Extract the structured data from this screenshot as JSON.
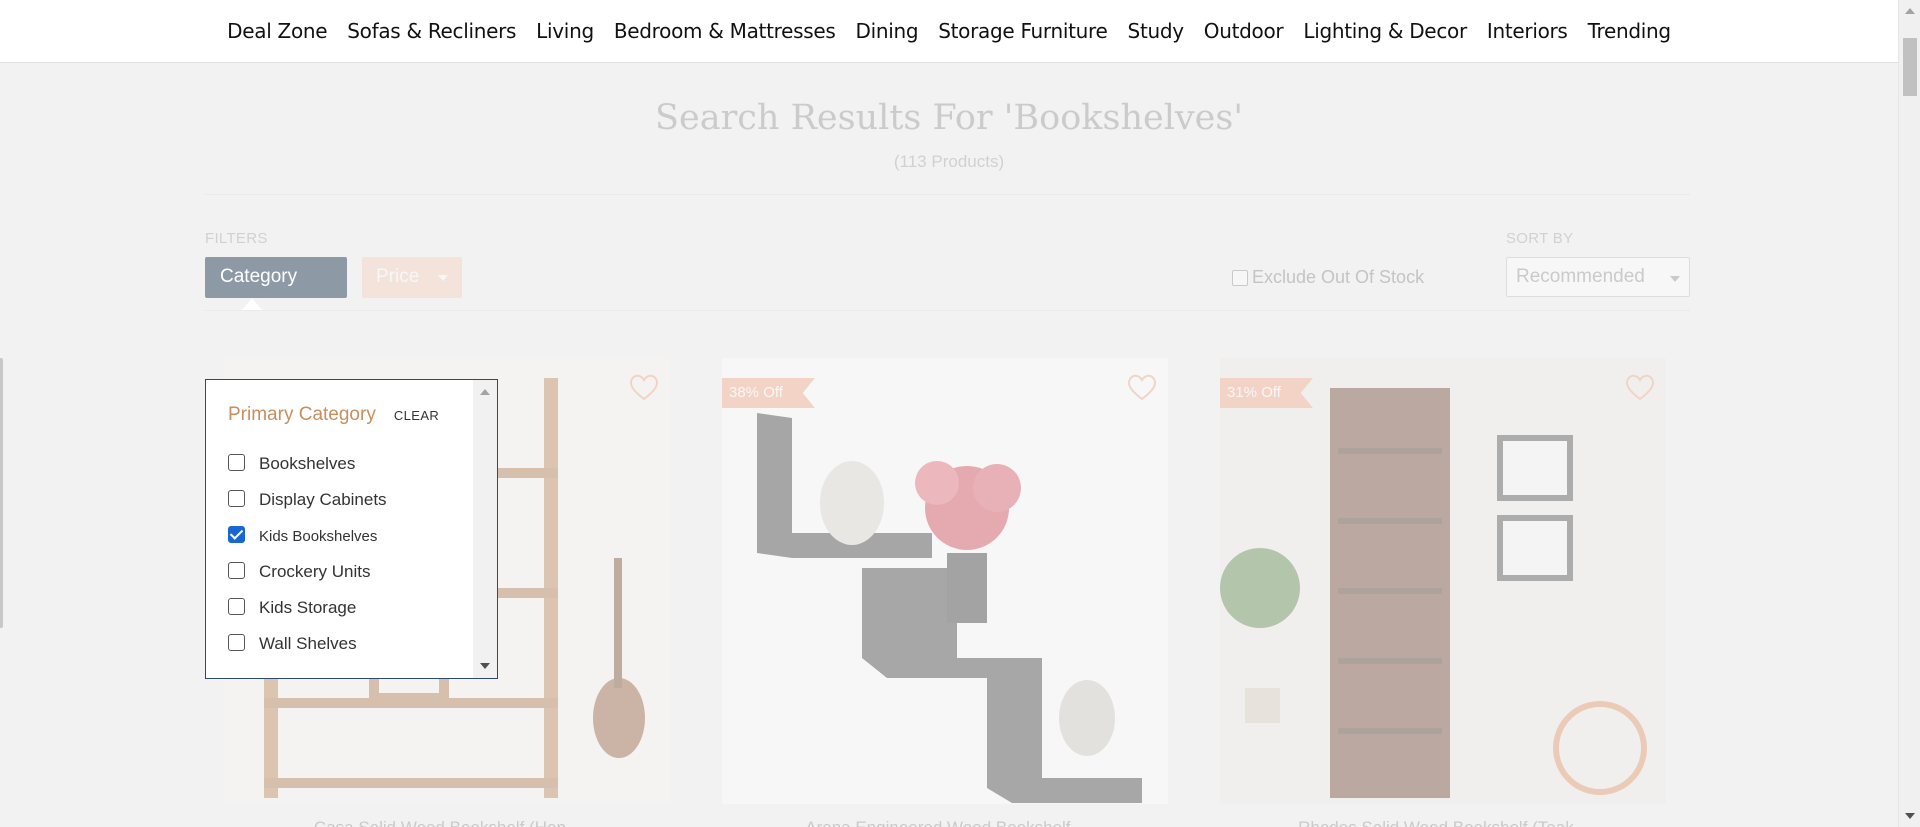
{
  "nav": {
    "items": [
      "Deal Zone",
      "Sofas & Recliners",
      "Living",
      "Bedroom & Mattresses",
      "Dining",
      "Storage Furniture",
      "Study",
      "Outdoor",
      "Lighting & Decor",
      "Interiors",
      "Trending"
    ]
  },
  "search": {
    "title": "Search Results For 'Bookshelves'",
    "count": "(113 Products)"
  },
  "filters": {
    "label": "FILTERS",
    "category_label": "Category",
    "price_label": "Price",
    "exclude_oos_label": "Exclude Out Of Stock"
  },
  "sort": {
    "label": "SORT BY",
    "selected": "Recommended"
  },
  "category_panel": {
    "title": "Primary Category",
    "clear_label": "CLEAR",
    "options": [
      {
        "label": "Bookshelves",
        "checked": false
      },
      {
        "label": "Display Cabinets",
        "checked": false
      },
      {
        "label": "Kids Bookshelves",
        "checked": true
      },
      {
        "label": "Crockery Units",
        "checked": false
      },
      {
        "label": "Kids Storage",
        "checked": false
      },
      {
        "label": "Wall Shelves",
        "checked": false
      }
    ]
  },
  "products": [
    {
      "badge": "",
      "name": "Casa Solid Wood Bookshelf (Hon..."
    },
    {
      "badge": "38% Off",
      "name": "Arena Engineered Wood Bookshelf..."
    },
    {
      "badge": "31% Off",
      "name": "Rhodes Solid Wood Bookshelf (Teak..."
    }
  ],
  "colors": {
    "accent": "#c68f5f",
    "category_button": "#8d99a5",
    "price_button": "#f3cbb4",
    "badge": "#f1a07b",
    "checkbox_checked": "#1a66d2"
  }
}
